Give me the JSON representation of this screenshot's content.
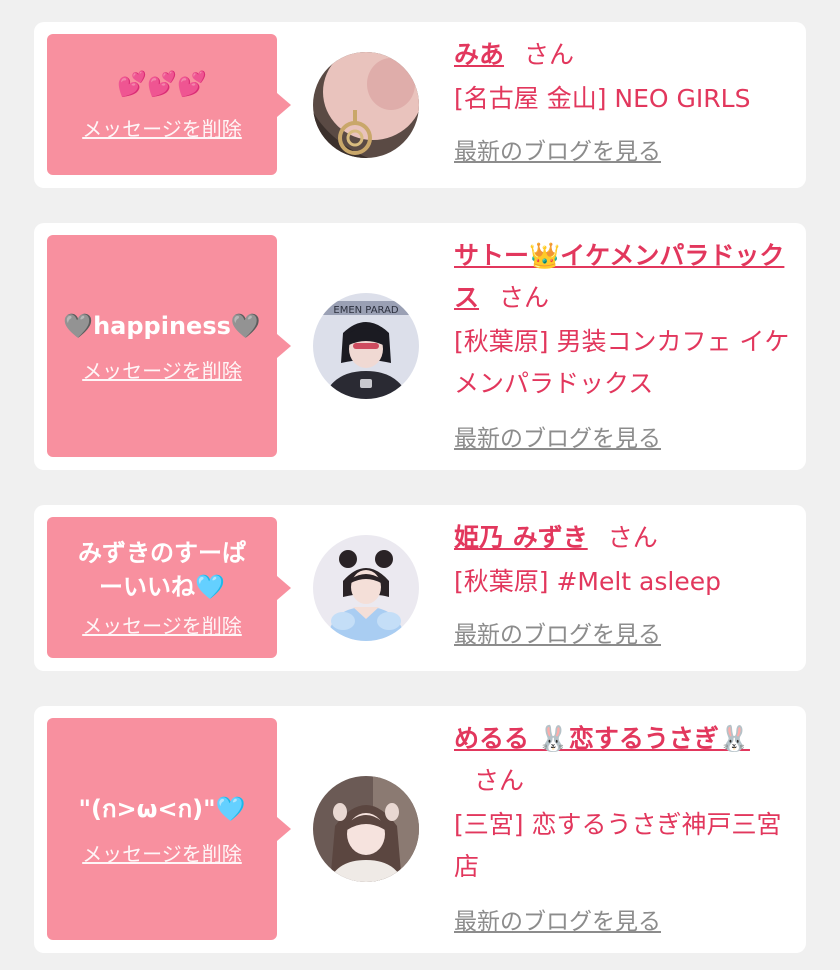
{
  "messages": [
    {
      "bubble_text": "💕💕💕",
      "delete_label": "メッセージを削除",
      "name": "みあ",
      "honorific": "さん",
      "shop": "[名古屋 金山] NEO GIRLS",
      "blog_link": "最新のブログを見る"
    },
    {
      "bubble_text": "🩶happiness🩶",
      "delete_label": "メッセージを削除",
      "name": "サトー👑イケメンパラドックス",
      "honorific": "さん",
      "shop": "[秋葉原] 男装コンカフェ イケメンパラドックス",
      "blog_link": "最新のブログを見る"
    },
    {
      "bubble_text": "みずきのすーぱーいいね🩵",
      "delete_label": "メッセージを削除",
      "name": "姫乃 みずき",
      "honorific": "さん",
      "shop": "[秋葉原] #Melt asleep",
      "blog_link": "最新のブログを見る"
    },
    {
      "bubble_text": "\"(ก>ω<ก)\"🩵",
      "delete_label": "メッセージを削除",
      "name": "めるる 🐰恋するうさぎ🐰",
      "honorific": "さん",
      "shop": "[三宮] 恋するうさぎ神戸三宮店",
      "blog_link": "最新のブログを見る"
    }
  ],
  "colors": {
    "bubble": "#f8909f",
    "accent": "#e2375d",
    "link_gray": "#8c8c8c",
    "background": "#f0f0f0"
  }
}
